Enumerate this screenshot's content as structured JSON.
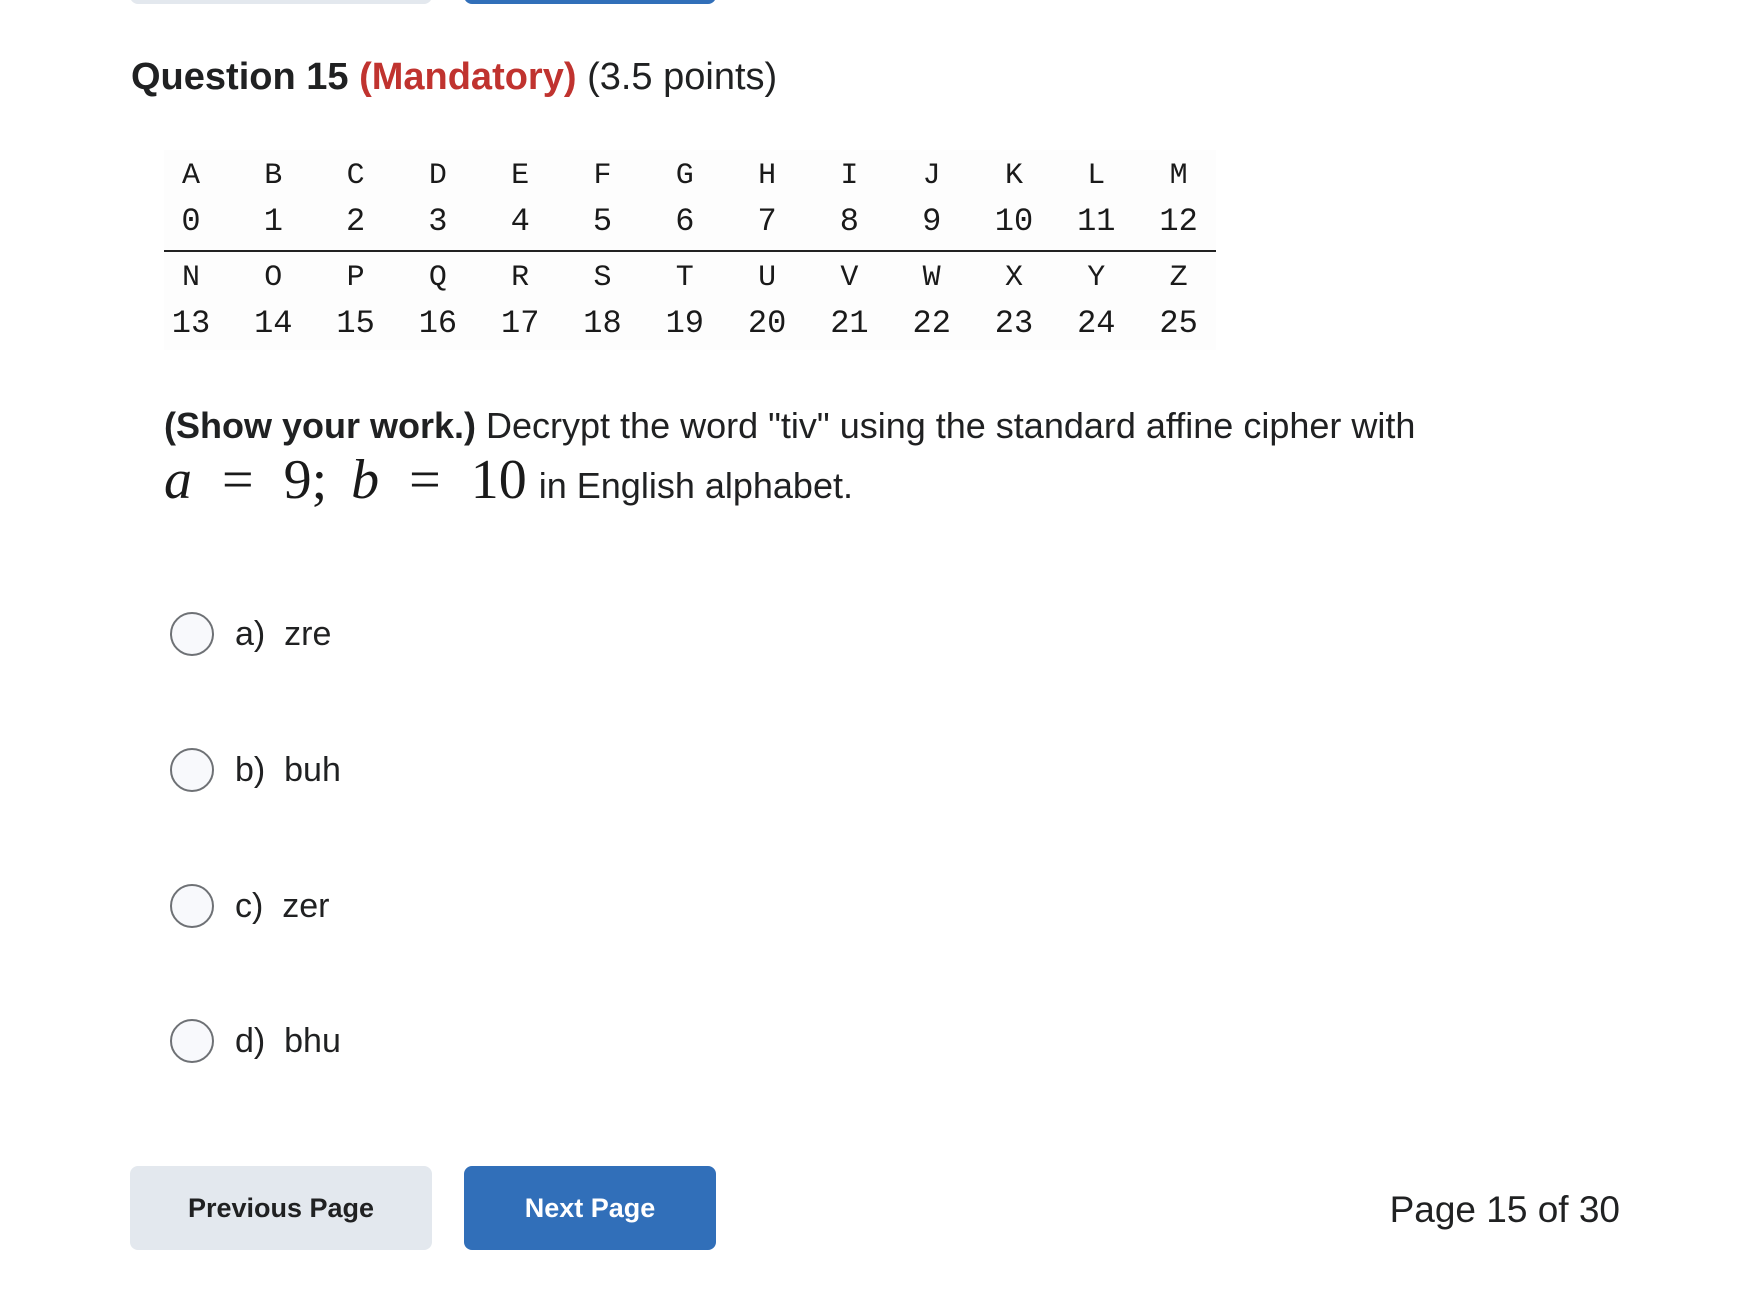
{
  "nav_top": {
    "prev_label": "",
    "next_label": ""
  },
  "question": {
    "number_label": "Question 15",
    "mandatory_label": "(Mandatory)",
    "points_label": "(3.5 points)",
    "colors": {
      "mandatory": "#c0332f",
      "text": "#202122"
    }
  },
  "cipher_table": {
    "rows": [
      {
        "letters": [
          "A",
          "B",
          "C",
          "D",
          "E",
          "F",
          "G",
          "H",
          "I",
          "J",
          "K",
          "L",
          "M"
        ],
        "numbers": [
          "0",
          "1",
          "2",
          "3",
          "4",
          "5",
          "6",
          "7",
          "8",
          "9",
          "10",
          "11",
          "12"
        ]
      },
      {
        "letters": [
          "N",
          "O",
          "P",
          "Q",
          "R",
          "S",
          "T",
          "U",
          "V",
          "W",
          "X",
          "Y",
          "Z"
        ],
        "numbers": [
          "13",
          "14",
          "15",
          "16",
          "17",
          "18",
          "19",
          "20",
          "21",
          "22",
          "23",
          "24",
          "25"
        ]
      }
    ]
  },
  "prompt": {
    "emphasis": "(Show your work.)",
    "text": " Decrypt the word \"tiv\" using the standard affine cipher with",
    "math": {
      "a_var": "a",
      "eq": "=",
      "a_val": "9;",
      "b_var": "b",
      "b_val": "10"
    },
    "tail": "in English alphabet."
  },
  "options": [
    {
      "label": "a)  zre",
      "selected": false
    },
    {
      "label": "b)  buh",
      "selected": false
    },
    {
      "label": "c)  zer",
      "selected": false
    },
    {
      "label": "d)  bhu",
      "selected": false
    }
  ],
  "footer": {
    "prev_label": "Previous Page",
    "next_label": "Next Page",
    "page_indicator": "Page 15 of 30",
    "colors": {
      "prev_bg": "#e3e8ee",
      "next_bg": "#316fb9"
    }
  }
}
